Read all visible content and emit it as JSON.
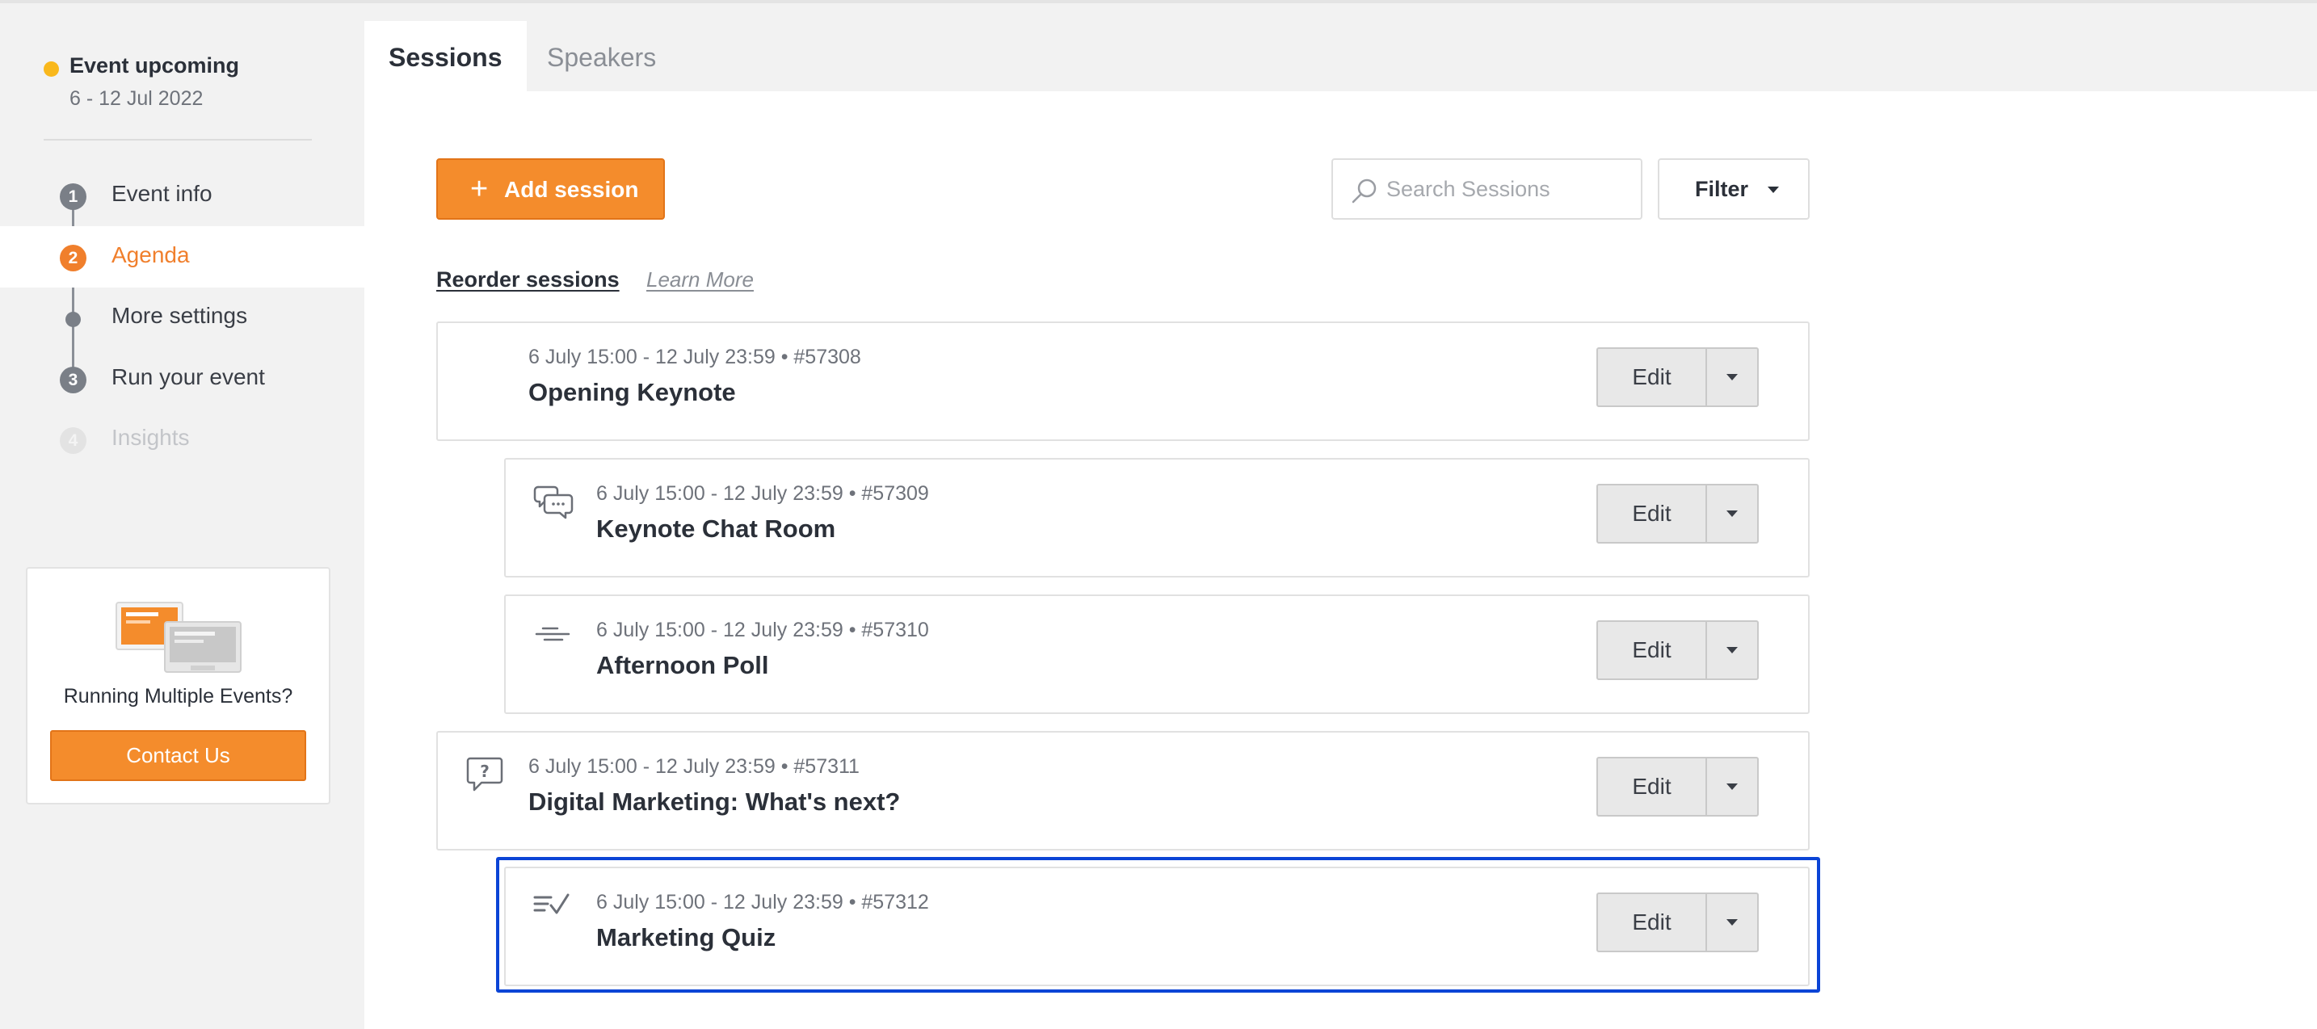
{
  "event": {
    "status": "Event upcoming",
    "dates": "6 - 12 Jul 2022"
  },
  "steps": [
    {
      "num": "1",
      "label": "Event info"
    },
    {
      "num": "2",
      "label": "Agenda"
    },
    {
      "num": "",
      "label": "More settings"
    },
    {
      "num": "3",
      "label": "Run your event"
    },
    {
      "num": "4",
      "label": "Insights"
    }
  ],
  "promo": {
    "text": "Running Multiple Events?",
    "button": "Contact Us"
  },
  "tabs": [
    "Sessions",
    "Speakers"
  ],
  "toolbar": {
    "add_plus": "+",
    "add_label": "Add session",
    "search_placeholder": "Search Sessions",
    "filter_label": "Filter",
    "reorder_label": "Reorder sessions",
    "learn_more": "Learn More"
  },
  "edit_label": "Edit",
  "sessions": [
    {
      "meta": "6 July 15:00 - 12 July 23:59  •  #57308",
      "title": "Opening Keynote",
      "icon": "none"
    },
    {
      "meta": "6 July 15:00 - 12 July 23:59  •  #57309",
      "title": "Keynote Chat Room",
      "icon": "chat-icon"
    },
    {
      "meta": "6 July 15:00 - 12 July 23:59  •  #57310",
      "title": "Afternoon Poll",
      "icon": "poll-icon"
    },
    {
      "meta": "6 July 15:00 - 12 July 23:59  •  #57311",
      "title": "Digital Marketing: What's next?",
      "icon": "question-icon"
    },
    {
      "meta": "6 July 15:00 - 12 July 23:59  •  #57312",
      "title": "Marketing Quiz",
      "icon": "quiz-icon"
    }
  ],
  "colors": {
    "accent": "#f48c2c",
    "status_dot": "#f9b81c",
    "selection": "#0b44d6"
  }
}
